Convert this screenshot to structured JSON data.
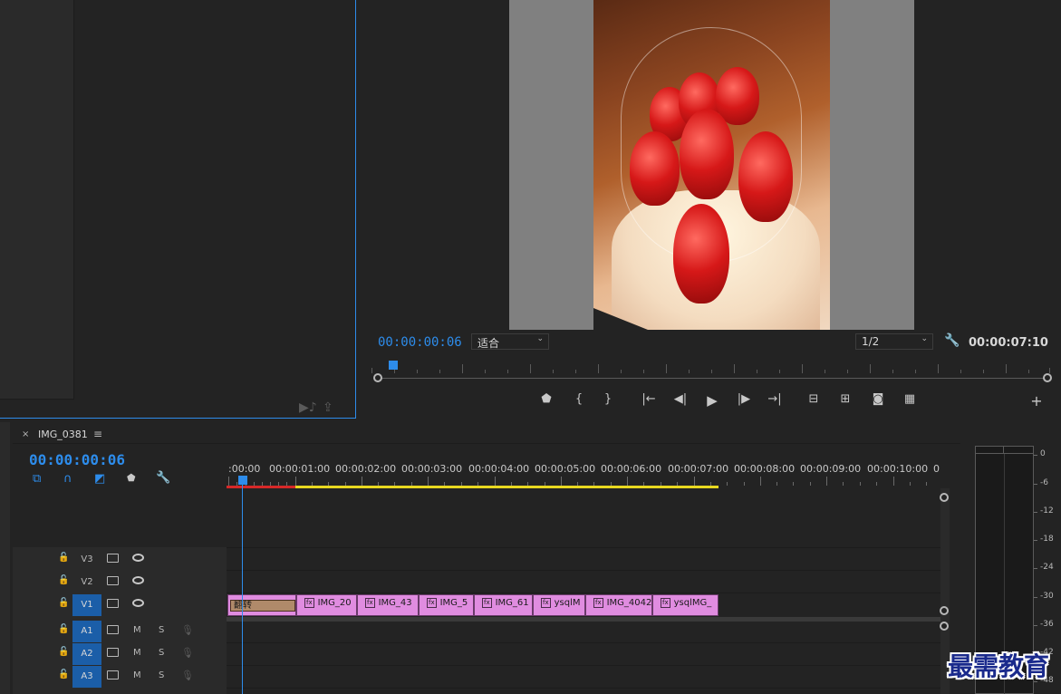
{
  "program": {
    "timecode_current": "00:00:00:06",
    "fit_value": "适合",
    "resolution_value": "1/2",
    "timecode_duration": "00:00:07:10"
  },
  "timeline": {
    "tab_label": "IMG_0381",
    "timecode": "00:00:00:06",
    "ruler_labels": [
      ":00:00",
      "00:00:01:00",
      "00:00:02:00",
      "00:00:03:00",
      "00:00:04:00",
      "00:00:05:00",
      "00:00:06:00",
      "00:00:07:00",
      "00:00:08:00",
      "00:00:09:00",
      "00:00:10:00",
      "0"
    ],
    "video_tracks": [
      "V3",
      "V2",
      "V1"
    ],
    "audio_tracks": [
      "A1",
      "A2",
      "A3"
    ],
    "mute_label": "M",
    "solo_label": "S",
    "transition_label": "翻转",
    "clips": [
      "IMG_20",
      "IMG_43",
      "IMG_5",
      "IMG_61",
      "ysqlM",
      "IMG_4042",
      "ysqlMG_"
    ]
  },
  "meter": {
    "db_labels": [
      "0",
      "-6",
      "-12",
      "-18",
      "-24",
      "-30",
      "-36",
      "-42",
      "-48"
    ]
  },
  "watermark": "最需教育",
  "colors": {
    "accent": "#2d8ceb",
    "clip": "#e08ce0",
    "work_area": "#e8d820",
    "in_red": "#d62828"
  }
}
